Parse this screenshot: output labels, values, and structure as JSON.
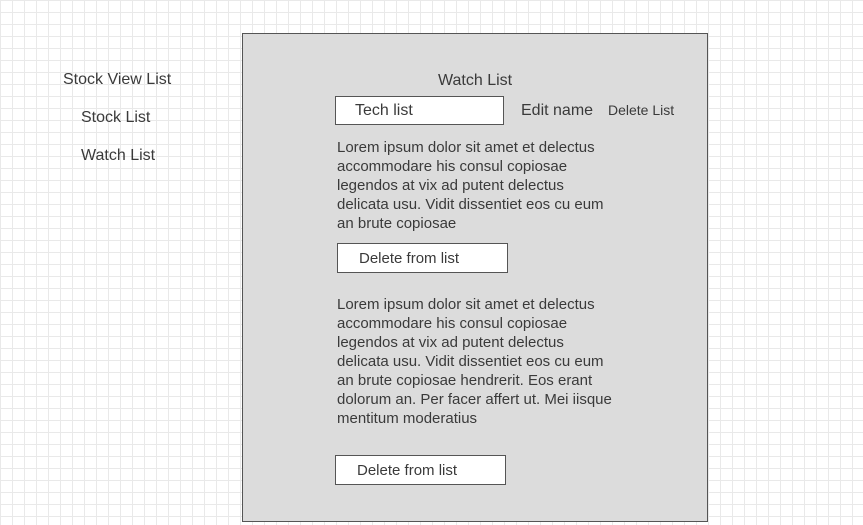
{
  "sidebar": {
    "title": "Stock View List",
    "items": [
      {
        "label": "Stock List"
      },
      {
        "label": "Watch List"
      }
    ]
  },
  "watchlist": {
    "title": "Watch List",
    "name_value": "Tech list",
    "edit_label": "Edit name",
    "delete_list_label": "Delete List",
    "items": [
      {
        "text": "Lorem ipsum dolor sit amet et delectus accommodare his consul copiosae legendos at vix ad putent delectus delicata usu. Vidit dissentiet eos cu eum an brute copiosae",
        "button_label": "Delete from list"
      },
      {
        "text": "Lorem ipsum dolor sit amet et delectus accommodare his consul copiosae legendos at vix ad putent delectus delicata usu. Vidit dissentiet eos cu eum an brute copiosae hendrerit. Eos erant dolorum an. Per facer affert ut. Mei iisque mentitum moderatius",
        "button_label": "Delete from list"
      }
    ]
  }
}
